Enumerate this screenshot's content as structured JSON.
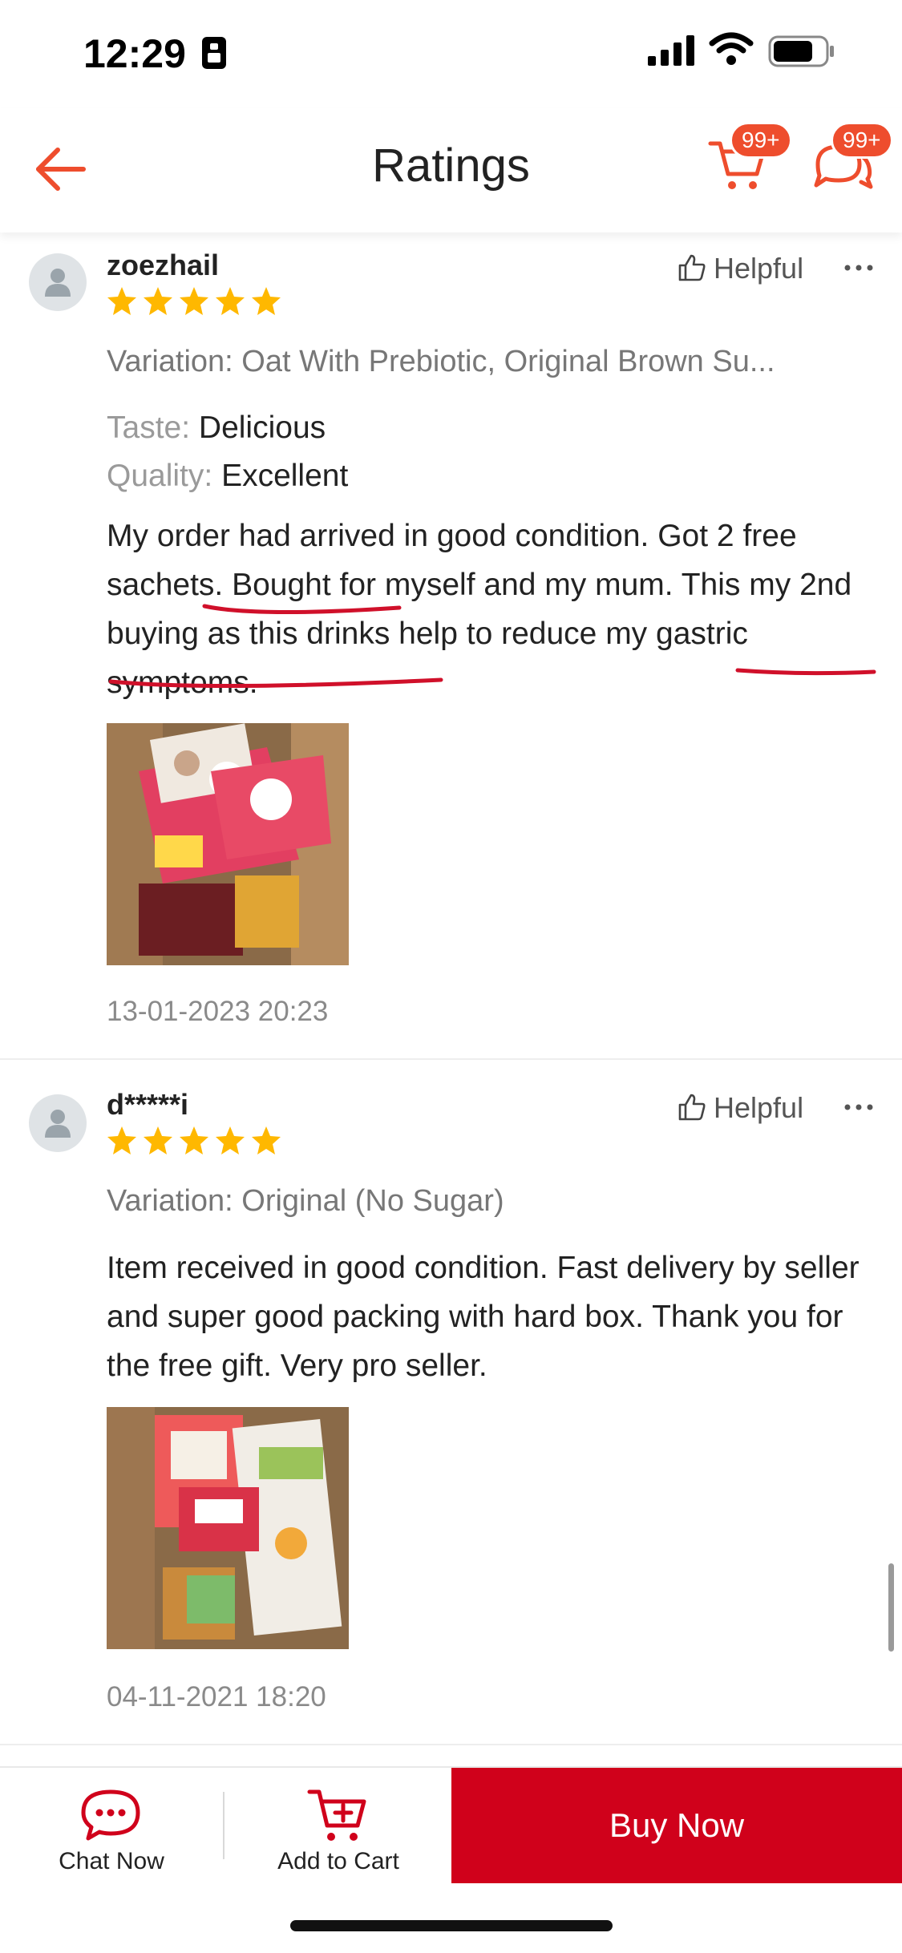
{
  "status_bar": {
    "time": "12:29"
  },
  "header": {
    "title": "Ratings",
    "cart_badge": "99+",
    "chat_badge": "99+"
  },
  "reviews": [
    {
      "username": "zoezhail",
      "stars": 5,
      "helpful_label": "Helpful",
      "variation": "Variation: Oat With Prebiotic, Original Brown Su...",
      "attributes": [
        {
          "key": "Taste:",
          "value": "Delicious"
        },
        {
          "key": "Quality:",
          "value": "Excellent"
        }
      ],
      "comment": "My order had arrived in good condition. Got 2 free sachets. Bought for myself and my mum. This my 2nd buying as this drinks help to reduce my gastric symptoms.",
      "date": "13-01-2023 20:23"
    },
    {
      "username": "d*****i",
      "stars": 5,
      "helpful_label": "Helpful",
      "variation": "Variation: Original (No Sugar)",
      "comment": "Item received in good condition. Fast delivery by seller and super good packing with hard box. Thank you for the free gift. Very pro seller.",
      "date": "04-11-2021 18:20"
    }
  ],
  "bottom_bar": {
    "chat_label": "Chat Now",
    "add_to_cart_label": "Add to Cart",
    "buy_now_label": "Buy Now"
  },
  "colors": {
    "accent": "#ee4d2d",
    "buy_now": "#d0011b",
    "star": "#ffb800"
  }
}
